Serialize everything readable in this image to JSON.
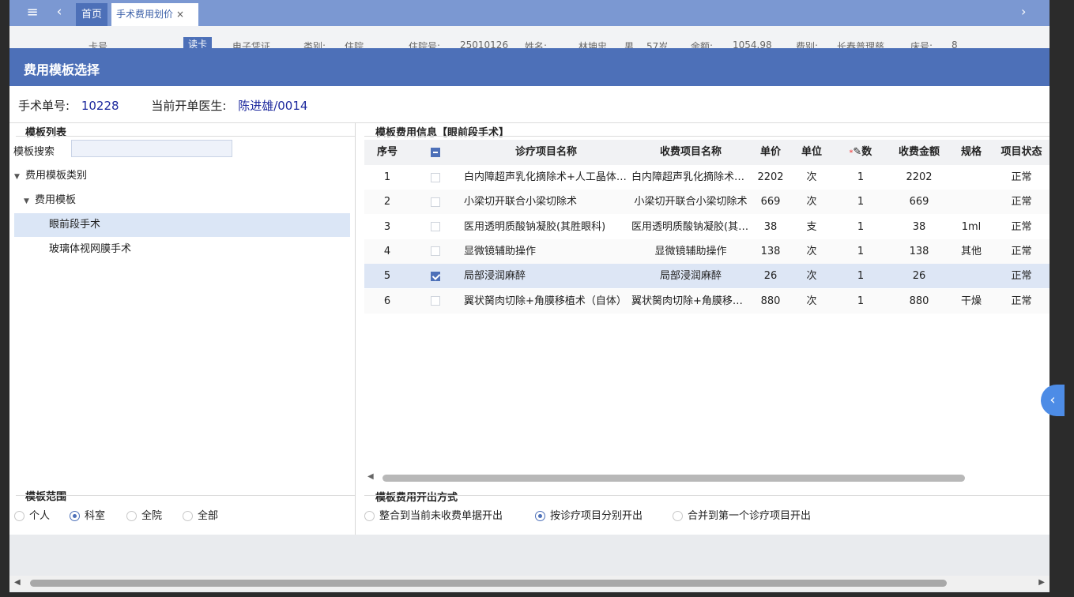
{
  "topbar": {
    "menu_icon": "≡",
    "back_icon": "‹",
    "forward_icon": "›",
    "tab_home": "首页",
    "tab_active": "手术费用划价",
    "tab_close": "×"
  },
  "toolbar": {
    "card_label": "卡号",
    "read_card": "读卡",
    "e_voucher": "电子凭证",
    "type_label": "类别:",
    "type_value": "住院",
    "inpatient_label": "住院号:",
    "inpatient_value": "25010126",
    "name_label": "姓名:",
    "name_value": "林坤忠",
    "gender": "男",
    "age": "57岁",
    "amount_label": "余额:",
    "amount_value": "1054.98",
    "fee_label": "费别:",
    "fee_value": "长春普理慈",
    "bed_label": "床号:",
    "bed_value": "8"
  },
  "dialog": {
    "title": "费用模板选择",
    "surgery_no_label": "手术单号:",
    "surgery_no": "10228",
    "doctor_label": "当前开单医生:",
    "doctor": "陈进雄/0014"
  },
  "left": {
    "list_title": "模板列表",
    "search_label": "模板搜索",
    "search_placeholder": "",
    "tree": [
      "费用模板类别",
      "费用模板",
      "眼前段手术",
      "玻璃体视网膜手术"
    ],
    "range_title": "模板范围",
    "range_options": [
      "个人",
      "科室",
      "全院",
      "全部"
    ],
    "range_selected": "科室"
  },
  "right": {
    "info_title": "模板费用信息【眼前段手术】",
    "columns": [
      "序号",
      "",
      "诊疗项目名称",
      "收费项目名称",
      "单价",
      "单位",
      "数",
      "收费金额",
      "规格",
      "项目状态"
    ],
    "rows": [
      {
        "no": "1",
        "checked": false,
        "item": "白内障超声乳化摘除术+人工晶体植入术",
        "charge": "白内障超声乳化摘除术+人工晶体植入术",
        "price": "2202",
        "unit": "次",
        "qty": "1",
        "amount": "2202",
        "spec": "",
        "status": "正常"
      },
      {
        "no": "2",
        "checked": false,
        "item": "小梁切开联合小梁切除术",
        "charge": "小梁切开联合小梁切除术",
        "price": "669",
        "unit": "次",
        "qty": "1",
        "amount": "669",
        "spec": "",
        "status": "正常"
      },
      {
        "no": "3",
        "checked": false,
        "item": "医用透明质酸钠凝胶(其胜眼科)",
        "charge": "医用透明质酸钠凝胶(其胜眼科)",
        "price": "38",
        "unit": "支",
        "qty": "1",
        "amount": "38",
        "spec": "1ml",
        "status": "正常"
      },
      {
        "no": "4",
        "checked": false,
        "item": "显微镜辅助操作",
        "charge": "显微镜辅助操作",
        "price": "138",
        "unit": "次",
        "qty": "1",
        "amount": "138",
        "spec": "其他",
        "status": "正常"
      },
      {
        "no": "5",
        "checked": true,
        "item": "局部浸润麻醉",
        "charge": "局部浸润麻醉",
        "price": "26",
        "unit": "次",
        "qty": "1",
        "amount": "26",
        "spec": "",
        "status": "正常"
      },
      {
        "no": "6",
        "checked": false,
        "item": "翼状胬肉切除+角膜移植术（自体）",
        "charge": "翼状胬肉切除+角膜移植术",
        "price": "880",
        "unit": "次",
        "qty": "1",
        "amount": "880",
        "spec": "干燥",
        "status": "正常"
      }
    ],
    "method_title": "模板费用开出方式",
    "method_options": [
      "整合到当前未收费单据开出",
      "按诊疗项目分别开出",
      "合并到第一个诊疗项目开出"
    ],
    "method_selected": "按诊疗项目分别开出"
  },
  "side_toggle_icon": "‹",
  "colors": {
    "header_blue": "#4d70b8",
    "topbar_blue": "#7b98d2",
    "link_blue": "#1e2a9e",
    "selected_row": "#dde6f5"
  }
}
